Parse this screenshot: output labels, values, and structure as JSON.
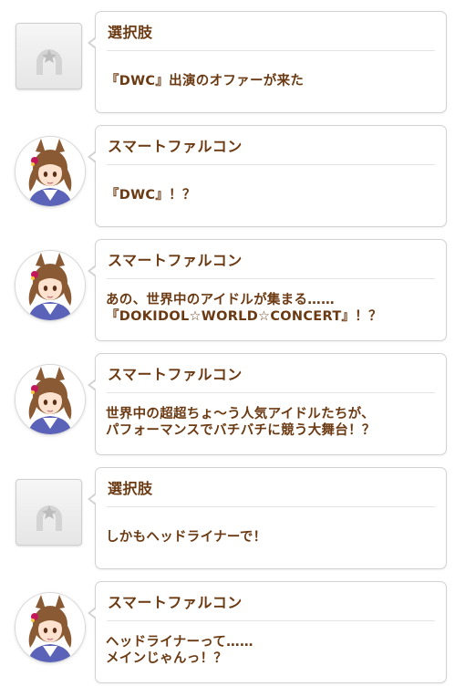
{
  "story_log": {
    "entries": [
      {
        "type": "choice",
        "speaker": "選択肢",
        "lines": [
          "『DWC』出演のオファーが来た"
        ],
        "avatar_icon": "horseshoe-icon"
      },
      {
        "type": "dialogue",
        "speaker": "スマートファルコン",
        "lines": [
          "『DWC』！？"
        ],
        "avatar_icon": "smart-falcon-portrait"
      },
      {
        "type": "dialogue",
        "speaker": "スマートファルコン",
        "lines": [
          "あの、世界中のアイドルが集まる……",
          "『DOKIDOL☆WORLD☆CONCERT』！？"
        ],
        "avatar_icon": "smart-falcon-portrait"
      },
      {
        "type": "dialogue",
        "speaker": "スマートファルコン",
        "lines": [
          "世界中の超超ちょ～う人気アイドルたちが、",
          "パフォーマンスでバチバチに競う大舞台！？"
        ],
        "avatar_icon": "smart-falcon-portrait"
      },
      {
        "type": "choice",
        "speaker": "選択肢",
        "lines": [
          "しかもヘッドライナーで！"
        ],
        "avatar_icon": "horseshoe-icon"
      },
      {
        "type": "dialogue",
        "speaker": "スマートファルコン",
        "lines": [
          "ヘッドライナーって……",
          "メインじゃんっ！？"
        ],
        "avatar_icon": "smart-falcon-portrait"
      }
    ]
  },
  "colors": {
    "text": "#6b3a12",
    "bubble_border": "#d2d2d2",
    "divider": "#e4e4e4",
    "hair": "#8a5a34"
  }
}
